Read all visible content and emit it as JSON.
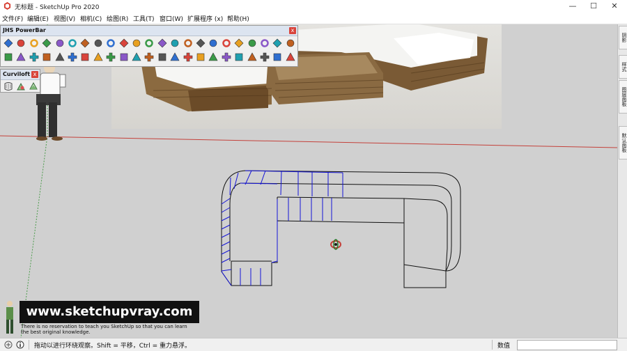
{
  "window": {
    "title": "无标题 - SketchUp Pro 2020",
    "controls": [
      "minimize",
      "maximize",
      "close"
    ]
  },
  "menu": [
    "文件(F)",
    "编辑(E)",
    "视图(V)",
    "相机(C)",
    "绘图(R)",
    "工具(T)",
    "窗口(W)",
    "扩展程序 (x)",
    "帮助(H)"
  ],
  "toolbars": {
    "jhs_powerbar": {
      "title": "JHS PowerBar",
      "close": "x"
    },
    "curviloft": {
      "title": "Curviloft",
      "close": "x"
    }
  },
  "tray_tabs": [
    "阴影",
    "样式",
    "图层面板",
    "默认面板"
  ],
  "watermark": {
    "url": "www.sketchupvray.com",
    "note_line1": "There is no reservation to teach you SketchUp so that you can learn",
    "note_line2": "the best original knowledge."
  },
  "status": {
    "text": "拖动以进行环绕观察。Shift = 平移，Ctrl = 重力悬浮。",
    "measure_label": "数值",
    "measure_value": ""
  },
  "colors": {
    "axis_red": "#c4403a",
    "axis_green": "#4a9b4a",
    "selected_edges": "#1414d8",
    "background": "#d0d0d0"
  }
}
